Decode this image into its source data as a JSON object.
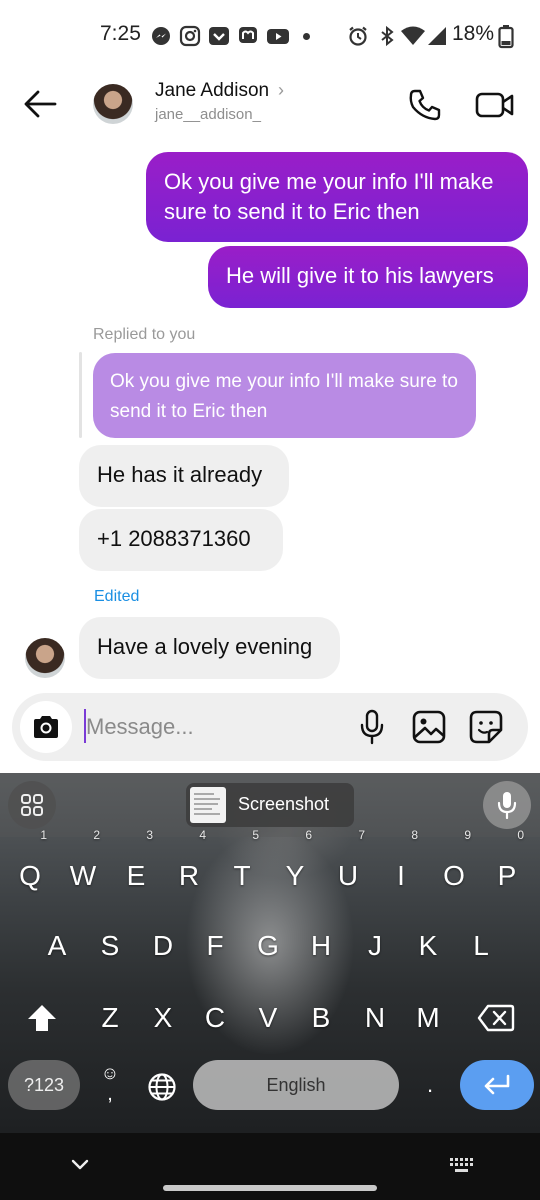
{
  "status_bar": {
    "time": "7:25",
    "battery": "18%"
  },
  "header": {
    "contact_name": "Jane Addison",
    "contact_handle": "jane__addison_"
  },
  "messages": {
    "sent": [
      "Ok you give me your info I'll make sure to send it to Eric then",
      "He will give it to his lawyers"
    ],
    "replied_label": "Replied to you",
    "reply_quote": "Ok you give me your info I'll make sure to send it to Eric then",
    "received": [
      "He has it already",
      "+1 2088371360"
    ],
    "edited_label": "Edited",
    "last_received": "Have a lovely evening"
  },
  "composer": {
    "placeholder": "Message..."
  },
  "keyboard": {
    "suggestion": "Screenshot",
    "row1": [
      {
        "key": "Q",
        "hint": "1"
      },
      {
        "key": "W",
        "hint": "2"
      },
      {
        "key": "E",
        "hint": "3"
      },
      {
        "key": "R",
        "hint": "4"
      },
      {
        "key": "T",
        "hint": "5"
      },
      {
        "key": "Y",
        "hint": "6"
      },
      {
        "key": "U",
        "hint": "7"
      },
      {
        "key": "I",
        "hint": "8"
      },
      {
        "key": "O",
        "hint": "9"
      },
      {
        "key": "P",
        "hint": "0"
      }
    ],
    "row2": [
      "A",
      "S",
      "D",
      "F",
      "G",
      "H",
      "J",
      "K",
      "L"
    ],
    "row3": [
      "Z",
      "X",
      "C",
      "V",
      "B",
      "N",
      "M"
    ],
    "symbols_label": "?123",
    "emoji_key": "☺",
    "space_label": "English",
    "period_label": "."
  },
  "colors": {
    "sent_bubble": "#8a20cc",
    "reply_quote": "#b98be4",
    "received_bubble": "#efefef",
    "edited_text": "#1a8fe3",
    "enter_key": "#5b9ef1"
  },
  "icons": [
    "back-arrow-icon",
    "chevron-right-icon",
    "phone-icon",
    "video-camera-icon",
    "camera-icon",
    "microphone-icon",
    "gallery-icon",
    "sticker-icon",
    "apps-grid-icon",
    "shift-icon",
    "backspace-icon",
    "globe-icon",
    "enter-icon",
    "chevron-down-icon",
    "keyboard-icon"
  ]
}
